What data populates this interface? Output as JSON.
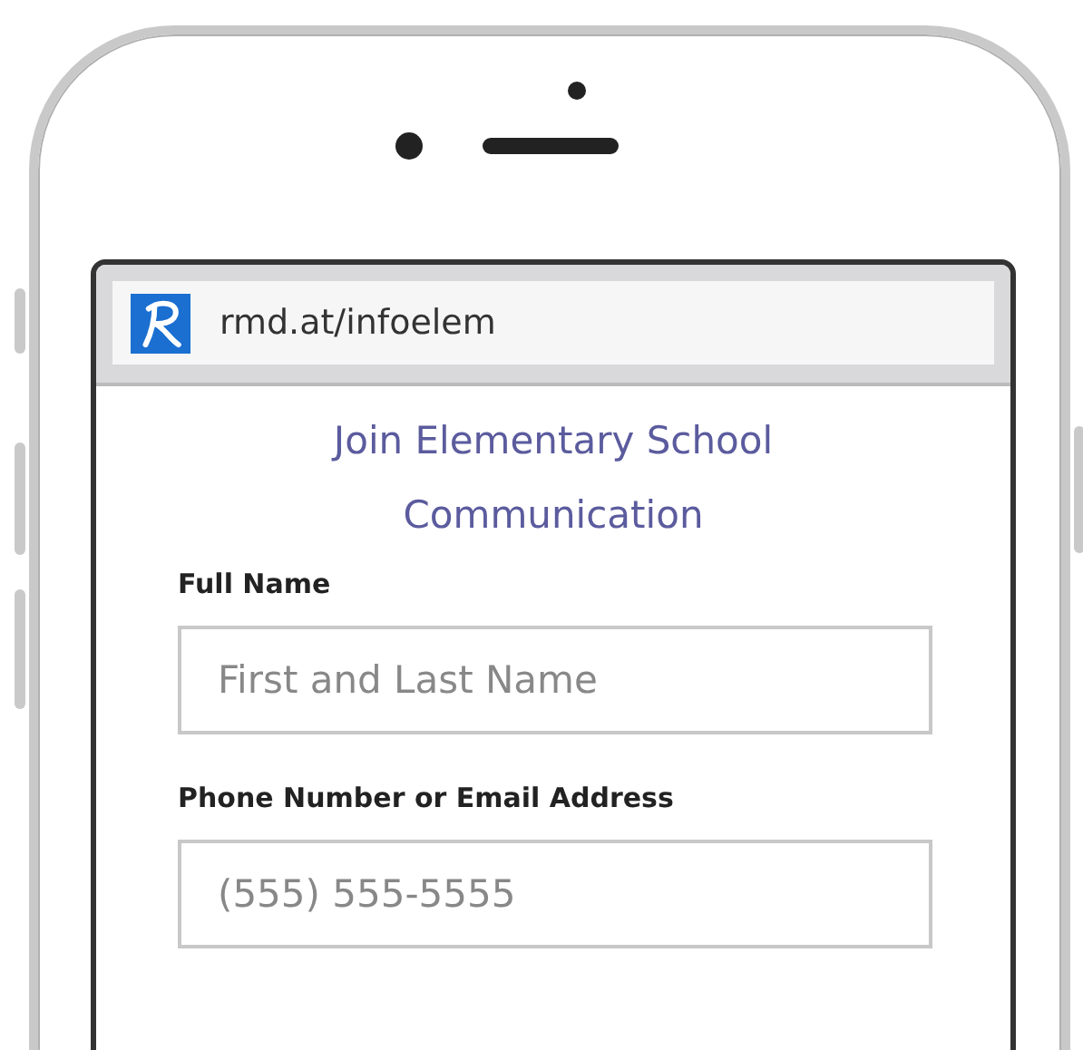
{
  "browser": {
    "url": "rmd.at/infoelem"
  },
  "form": {
    "title": "Join Elementary School Communication",
    "fields": [
      {
        "label": "Full Name",
        "placeholder": "First and Last Name"
      },
      {
        "label": "Phone Number or Email Address",
        "placeholder": "(555) 555-5555"
      }
    ]
  }
}
